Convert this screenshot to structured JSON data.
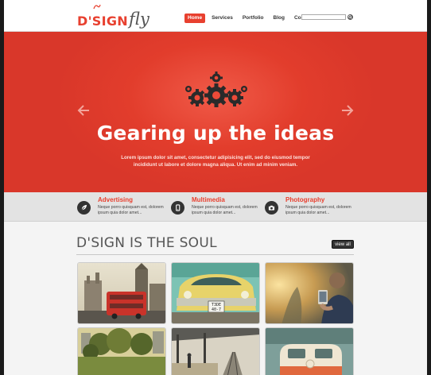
{
  "header": {
    "logo_main": "D'SIGN",
    "logo_sub": "fly",
    "nav": [
      "Home",
      "Services",
      "Portfolio",
      "Blog",
      "Contact"
    ],
    "active_nav": "Home",
    "search_value": ""
  },
  "hero": {
    "title": "Gearing up the ideas",
    "text": "Lorem ipsum dolor sit amet, consectetur adipisicing elit, sed do eiusmod tempor incididunt ut labore et dolore magna aliqua. Ut enim ad minim veniam.",
    "icon": "gears-icon"
  },
  "services": [
    {
      "title": "Advertising",
      "text": "Neque porro quisquam est, dolorem ipsum quia dolor amet...",
      "icon": "leaf-icon"
    },
    {
      "title": "Multimedia",
      "text": "Neque porro quisquam est, dolorem ipsum quia dolor amet...",
      "icon": "phone-icon"
    },
    {
      "title": "Photography",
      "text": "Neque porro quisquam est, dolorem ipsum quia dolor amet...",
      "icon": "camera-icon"
    }
  ],
  "portfolio": {
    "title": "D'SIGN IS THE SOUL",
    "view_all": "view all",
    "license_plate": "T3DE\n40-7"
  },
  "colors": {
    "accent": "#e8402f",
    "dark": "#333333"
  }
}
